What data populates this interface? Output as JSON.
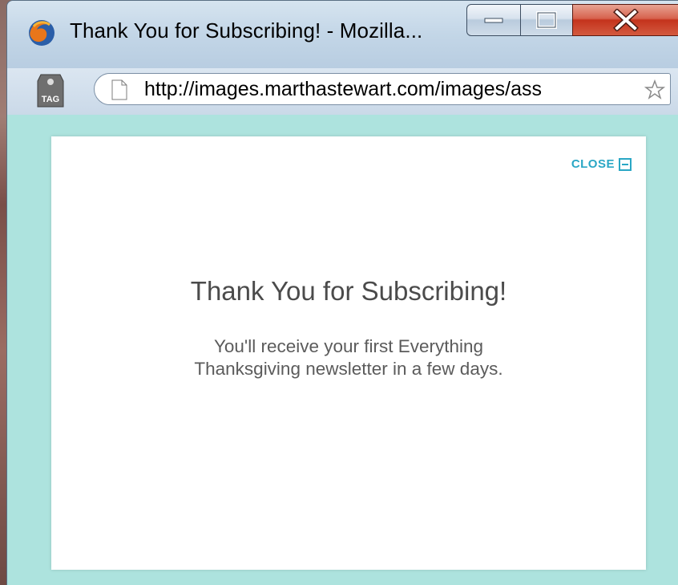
{
  "window": {
    "title": "Thank You for Subscribing! - Mozilla...",
    "buttons": {
      "minimize": "minimize",
      "maximize": "maximize",
      "close": "close"
    }
  },
  "navbar": {
    "tag_label": "TAG",
    "url": "http://images.marthastewart.com/images/ass"
  },
  "modal": {
    "close_label": "CLOSE",
    "title": "Thank You for Subscribing!",
    "message_line1": "You'll receive your first Everything",
    "message_line2": "Thanksgiving newsletter in a few days."
  },
  "colors": {
    "background": "#ade3de",
    "accent": "#2aa7c5",
    "title_text": "#4b4b4b"
  },
  "icons": [
    "firefox-icon",
    "tag-icon",
    "page-icon",
    "star-icon",
    "close-box-icon"
  ]
}
